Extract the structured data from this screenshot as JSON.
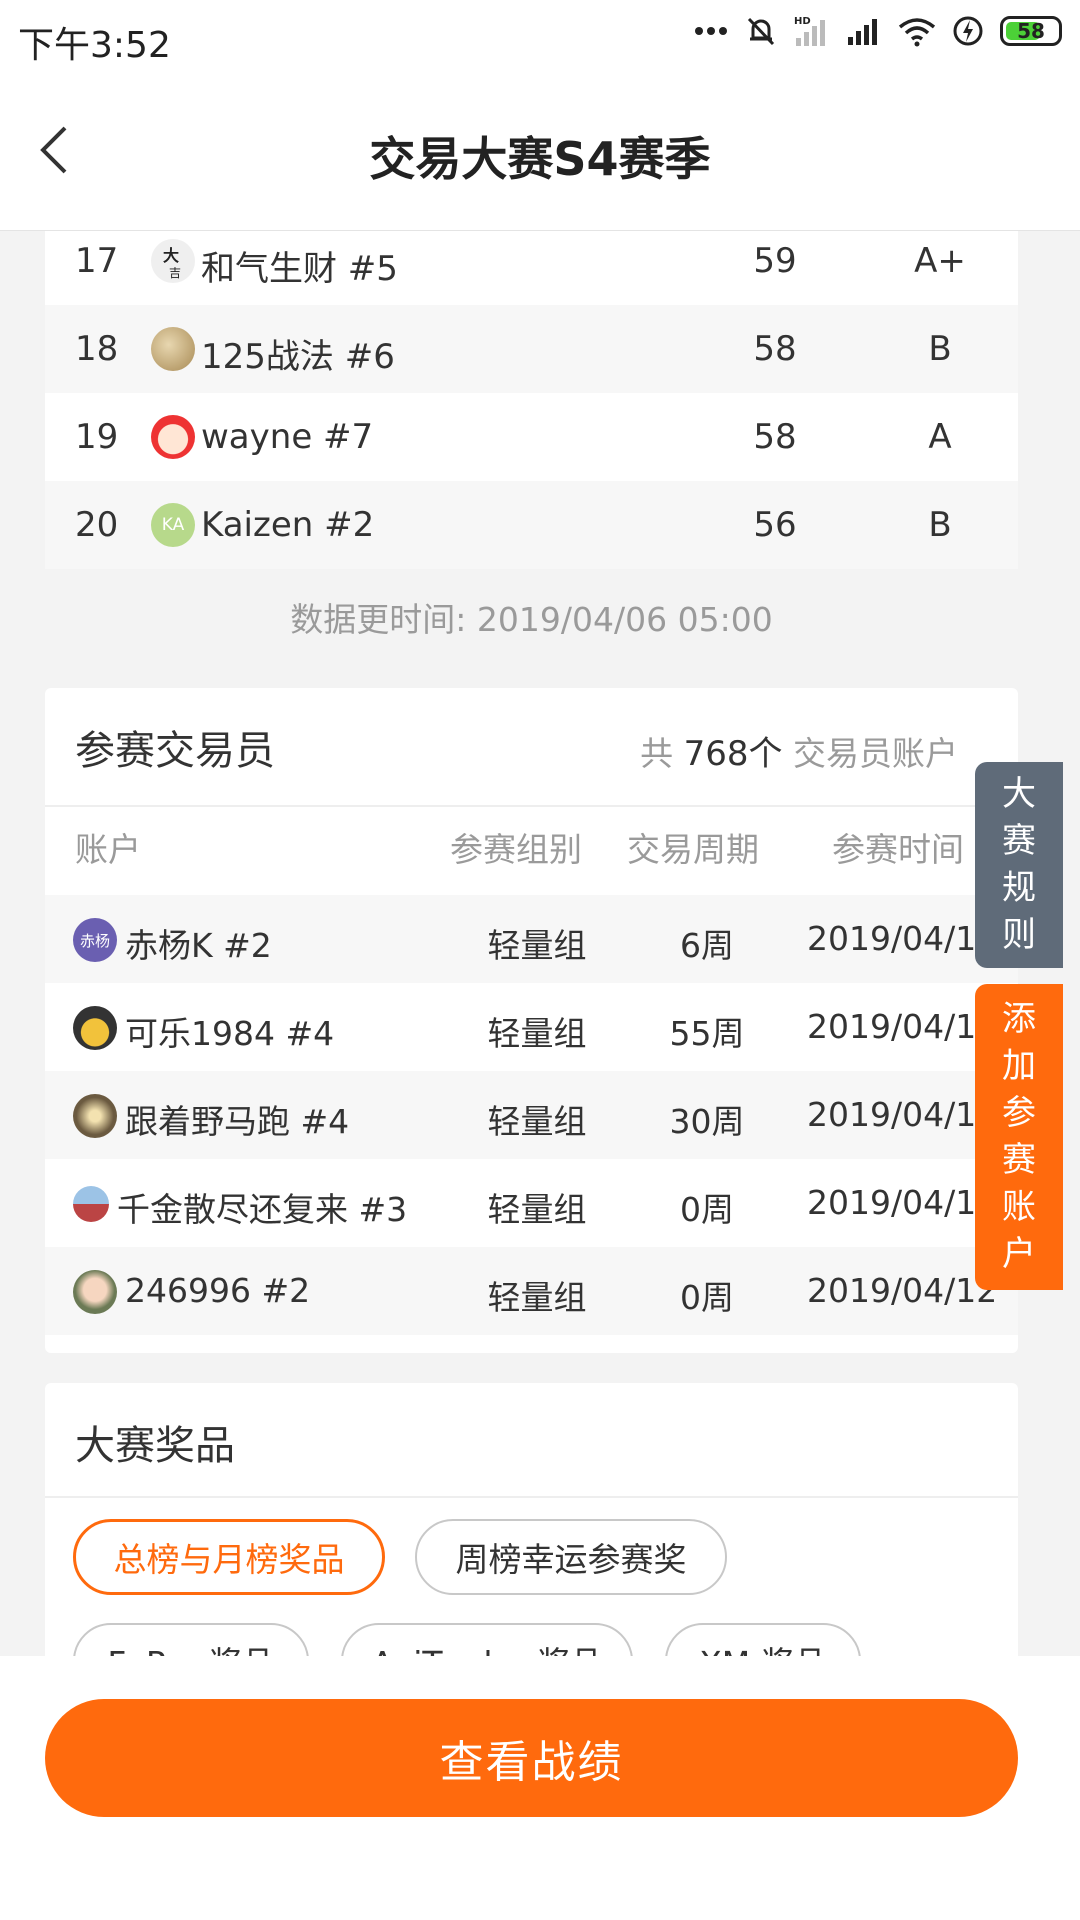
{
  "status_bar": {
    "time": "下午3:52",
    "battery": "58"
  },
  "header": {
    "title": "交易大赛S4赛季"
  },
  "ranking": {
    "rows": [
      {
        "rank": "17",
        "name": "和气生财  #5",
        "score": "59",
        "grade": "A+"
      },
      {
        "rank": "18",
        "name": "125战法  #6",
        "score": "58",
        "grade": "B"
      },
      {
        "rank": "19",
        "name": "wayne  #7",
        "score": "58",
        "grade": "A"
      },
      {
        "rank": "20",
        "name": "Kaizen  #2",
        "score": "56",
        "grade": "B"
      }
    ],
    "kaizen_avatar_text": "KA",
    "update_time": "数据更时间: 2019/04/06 05:00"
  },
  "traders": {
    "title": "参赛交易员",
    "count_prefix": "共",
    "count": "768个",
    "count_suffix": "交易员账户",
    "headers": {
      "account": "账户",
      "group": "参赛组别",
      "period": "交易周期",
      "time": "参赛时间"
    },
    "first_avatar_text": "赤杨",
    "rows": [
      {
        "name": "赤杨K  #2",
        "group": "轻量组",
        "period": "6周",
        "date": "2019/04/12"
      },
      {
        "name": "可乐1984  #4",
        "group": "轻量组",
        "period": "55周",
        "date": "2019/04/12"
      },
      {
        "name": "跟着野马跑  #4",
        "group": "轻量组",
        "period": "30周",
        "date": "2019/04/12"
      },
      {
        "name": "千金散尽还复来  #3",
        "group": "轻量组",
        "period": "0周",
        "date": "2019/04/12"
      },
      {
        "name": "246996  #2",
        "group": "轻量组",
        "period": "0周",
        "date": "2019/04/12"
      }
    ]
  },
  "prizes": {
    "title": "大赛奖品",
    "tabs": [
      "总榜与月榜奖品",
      "周榜幸运参赛奖"
    ],
    "more_tabs": [
      "FxPro 奖品",
      "AxiTrader 奖品",
      "XM 奖品"
    ]
  },
  "floating": {
    "rules": "大赛规则",
    "add": "添加参赛账户"
  },
  "bottom": {
    "button": "查看战绩"
  },
  "colors": {
    "accent": "#ff6a0d",
    "rules_bg": "#5f6b79"
  }
}
